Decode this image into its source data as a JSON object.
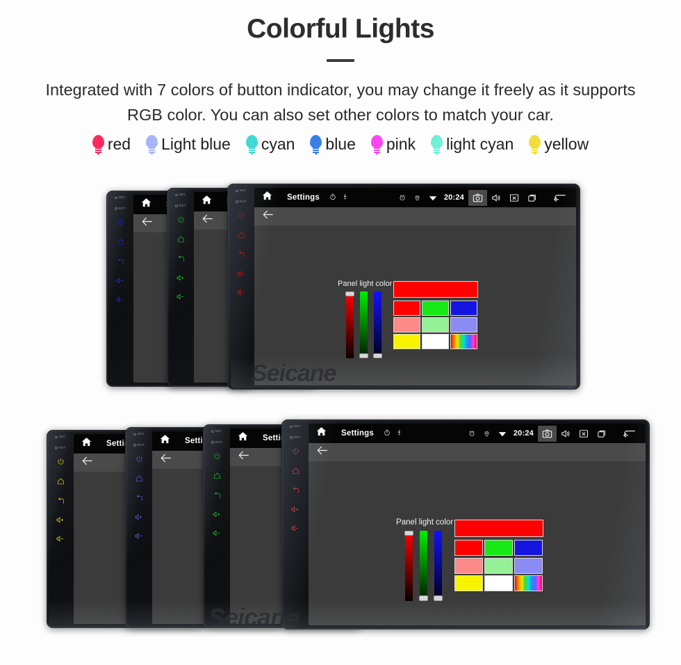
{
  "header": {
    "title": "Colorful Lights",
    "subtitle": "Integrated with 7 colors of button indicator, you may change it freely as it supports RGB color. You can also set other colors to match your car."
  },
  "legend": {
    "items": [
      {
        "label": "red",
        "color": "#fb2b5e",
        "icon": "bulb-icon"
      },
      {
        "label": "Light blue",
        "color": "#a8b4f8",
        "icon": "bulb-icon"
      },
      {
        "label": "cyan",
        "color": "#3fd8d3",
        "icon": "bulb-icon"
      },
      {
        "label": "blue",
        "color": "#3a7ee8",
        "icon": "bulb-icon"
      },
      {
        "label": "pink",
        "color": "#fb46ee",
        "icon": "bulb-icon"
      },
      {
        "label": "light cyan",
        "color": "#70f0d6",
        "icon": "bulb-icon"
      },
      {
        "label": "yellow",
        "color": "#f2dd3e",
        "icon": "bulb-icon"
      }
    ]
  },
  "device_ui": {
    "statusbar": {
      "home_icon": "home-icon",
      "title": "Settings",
      "timer_icon": "timer-icon",
      "mic_icon": "microphone-icon",
      "alarm_icon": "alarm-icon",
      "location_icon": "location-pin-icon",
      "wifi_icon": "wifi-icon",
      "clock": "20:24",
      "screenshot_icon": "camera-icon",
      "volume_icon": "speaker-icon",
      "close_icon": "close-box-icon",
      "recents_icon": "recents-icon",
      "back_icon": "back-arrow-icon"
    },
    "actionbar": {
      "back_icon": "back-arrow-icon"
    },
    "panel": {
      "label": "Panel light color",
      "sliders": [
        {
          "name": "red-slider",
          "channel": "R",
          "thumb_position": "top"
        },
        {
          "name": "green-slider",
          "channel": "G",
          "thumb_position": "bottom"
        },
        {
          "name": "blue-slider",
          "channel": "B",
          "thumb_position": "bottom"
        }
      ],
      "preview_color": "#fe0000",
      "swatches": [
        [
          "#fe0000",
          "#16e916",
          "#1515e2"
        ],
        [
          "#fb8a88",
          "#94f196",
          "#8b8bf6"
        ],
        [
          "#f8f400",
          "#ffffff",
          "spectrum"
        ]
      ]
    },
    "keystrip": {
      "mic_label": "MIC",
      "rst_label": "RST",
      "keys": [
        "power-icon",
        "home-icon",
        "back-icon",
        "volume-up-icon",
        "volume-down-icon"
      ]
    }
  },
  "device_groups": [
    {
      "name": "device-group-top",
      "devices": [
        {
          "name": "device-blue",
          "key_color": "#1d2fe6",
          "full": false
        },
        {
          "name": "device-green",
          "key_color": "#11cc22",
          "full": false
        },
        {
          "name": "device-red",
          "key_color": "#e01010",
          "full": true
        }
      ]
    },
    {
      "name": "device-group-bottom",
      "devices": [
        {
          "name": "device-yellow",
          "key_color": "#e2d514",
          "full": false
        },
        {
          "name": "device-purple",
          "key_color": "#6a5ce0",
          "full": false
        },
        {
          "name": "device-green-2",
          "key_color": "#14c91f",
          "full": false
        },
        {
          "name": "device-red-2",
          "key_color": "#d8474a",
          "full": true
        }
      ]
    }
  ],
  "watermark": {
    "text": "Seicane"
  }
}
